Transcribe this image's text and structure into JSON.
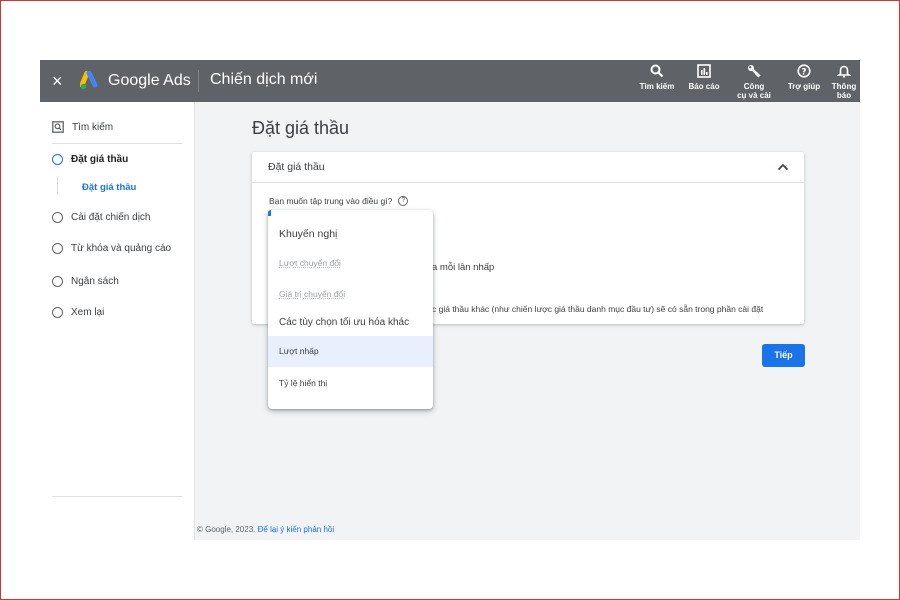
{
  "topbar": {
    "close_icon": "×",
    "brand": "Google Ads",
    "page_name": "Chiến dịch mới",
    "tools": [
      {
        "icon": "search-icon",
        "label_line1": "Tìm kiếm",
        "label_line2": ""
      },
      {
        "icon": "reports-icon",
        "label_line1": "Báo cáo",
        "label_line2": ""
      },
      {
        "icon": "wrench-icon",
        "label_line1": "Công",
        "label_line2": "cụ và cài"
      },
      {
        "icon": "help-icon",
        "label_line1": "Trợ giúp",
        "label_line2": ""
      },
      {
        "icon": "bell-icon",
        "label_line1": "Thông",
        "label_line2": "báo"
      }
    ]
  },
  "sidebar": {
    "items": [
      {
        "label": "Tìm kiếm",
        "icon": "search-box-icon"
      },
      {
        "label": "Đặt giá thầu",
        "icon": "circle-icon"
      },
      {
        "label": "Cài đặt chiến dịch",
        "icon": "circle-icon"
      },
      {
        "label": "Từ khóa và quảng cáo",
        "icon": "circle-icon"
      },
      {
        "label": "Ngân sách",
        "icon": "circle-icon"
      },
      {
        "label": "Xem lại",
        "icon": "circle-icon"
      }
    ],
    "sub_item": "Đặt giá thầu"
  },
  "main": {
    "title": "Đặt giá thầu",
    "card": {
      "title": "Đặt giá thầu",
      "question": "Bạn muốn tập trung vào điều gì?",
      "help_icon": "?",
      "partial_line1": "a mỗi lần nhấp",
      "partial_line2": "c giá thầu khác (như chiến lược giá thầu danh mục đầu tư) sẽ có sẵn trong phần cài đặt"
    },
    "next_button": "Tiếp"
  },
  "dropdown": {
    "heading_recommended": "Khuyến nghị",
    "disabled_options": [
      "Lượt chuyển đổi",
      "Giá trị chuyển đổi"
    ],
    "heading_other": "Các tùy chọn tối ưu hóa khác",
    "options": [
      "Lượt nhấp",
      "Tỷ lệ hiển thị"
    ],
    "highlighted": "Lượt nhấp"
  },
  "footer": {
    "text": "© Google, 2023.",
    "link": "Để lại ý kiến phản hồi"
  },
  "colors": {
    "topbar": "#5f6368",
    "accent": "#1a73e8",
    "frame_border": "#d9332b",
    "highlight": "#e8f0fe"
  }
}
